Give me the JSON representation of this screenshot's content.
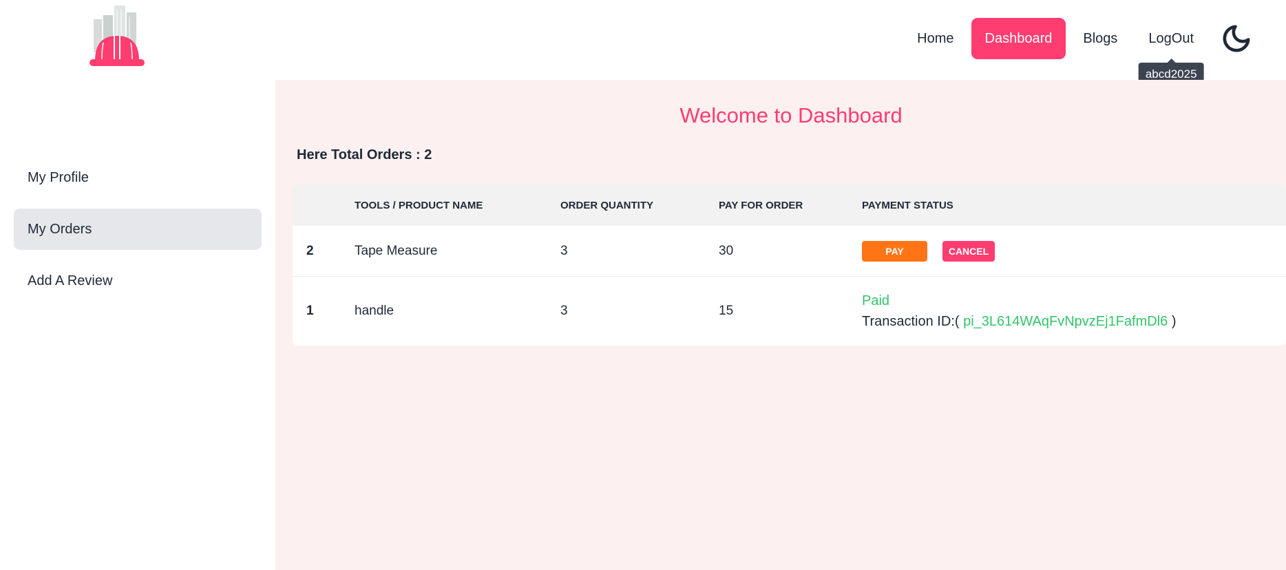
{
  "nav": {
    "items": [
      {
        "label": "Home",
        "active": false
      },
      {
        "label": "Dashboard",
        "active": true
      },
      {
        "label": "Blogs",
        "active": false
      },
      {
        "label": "LogOut",
        "active": false
      }
    ],
    "user_tooltip": "abcd2025",
    "theme_icon": "moon-icon"
  },
  "sidebar": {
    "items": [
      {
        "label": "My Profile",
        "active": false
      },
      {
        "label": "My Orders",
        "active": true
      },
      {
        "label": "Add A Review",
        "active": false
      }
    ]
  },
  "main": {
    "title": "Welcome to Dashboard",
    "total_orders_label": "Here Total Orders : 2",
    "table": {
      "headers": [
        "",
        "TOOLS / PRODUCT NAME",
        "ORDER QUANTITY",
        "PAY FOR ORDER",
        "PAYMENT STATUS"
      ],
      "rows": [
        {
          "index": "2",
          "name": "Tape Measure",
          "quantity": "3",
          "price": "30",
          "pay_label": "PAY",
          "cancel_label": "CANCEL"
        },
        {
          "index": "1",
          "name": "handle",
          "quantity": "3",
          "price": "15",
          "status": "Paid",
          "transaction_prefix": "Transaction ID:(",
          "transaction_id": "pi_3L614WAqFvNpvzEj1FafmDl6",
          "transaction_suffix": ")"
        }
      ]
    }
  },
  "colors": {
    "accent": "#ff3d71",
    "pay_button": "#ff7516",
    "paid_text": "#33c46b",
    "content_bg": "#fcf0f1"
  }
}
